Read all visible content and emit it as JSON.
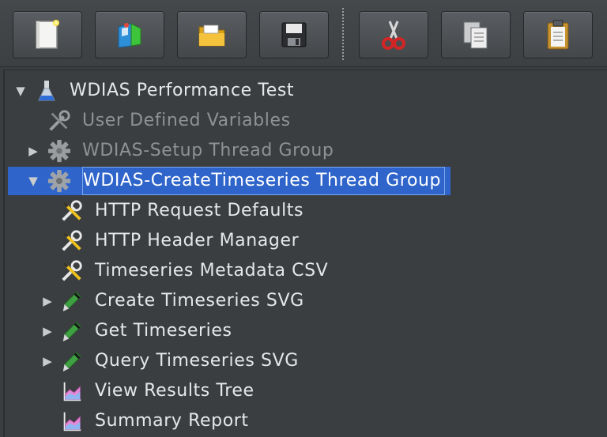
{
  "toolbar": {
    "buttons": [
      {
        "name": "new",
        "icon": "new-document-icon"
      },
      {
        "name": "templates",
        "icon": "templates-icon"
      },
      {
        "name": "open",
        "icon": "open-folder-icon"
      },
      {
        "name": "save",
        "icon": "save-floppy-icon"
      },
      {
        "name": "cut",
        "icon": "scissors-icon"
      },
      {
        "name": "copy",
        "icon": "copy-icon"
      },
      {
        "name": "paste",
        "icon": "clipboard-icon"
      }
    ]
  },
  "tree": {
    "items": [
      {
        "label": "WDIAS Performance Test",
        "icon": "flask-icon",
        "toggle": "expanded",
        "enabled": true
      },
      {
        "label": "User Defined Variables",
        "icon": "wrench-icon",
        "toggle": "none",
        "enabled": false
      },
      {
        "label": "WDIAS-Setup Thread Group",
        "icon": "gear-icon",
        "toggle": "collapsed",
        "enabled": false
      },
      {
        "label": "WDIAS-CreateTimeseries Thread Group",
        "icon": "gear-icon",
        "toggle": "expanded",
        "enabled": true,
        "selected": true
      },
      {
        "label": "HTTP Request Defaults",
        "icon": "config-tools-icon",
        "toggle": "none",
        "enabled": true
      },
      {
        "label": "HTTP Header Manager",
        "icon": "config-tools-icon",
        "toggle": "none",
        "enabled": true
      },
      {
        "label": "Timeseries Metadata CSV",
        "icon": "config-tools-icon",
        "toggle": "none",
        "enabled": true
      },
      {
        "label": "Create Timeseries SVG",
        "icon": "pipette-icon",
        "toggle": "collapsed",
        "enabled": true
      },
      {
        "label": "Get Timeseries",
        "icon": "pipette-icon",
        "toggle": "collapsed",
        "enabled": true
      },
      {
        "label": "Query Timeseries SVG",
        "icon": "pipette-icon",
        "toggle": "collapsed",
        "enabled": true
      },
      {
        "label": "View Results Tree",
        "icon": "report-chart-icon",
        "toggle": "none",
        "enabled": true
      },
      {
        "label": "Summary Report",
        "icon": "report-chart-icon",
        "toggle": "none",
        "enabled": true
      }
    ]
  },
  "colors": {
    "background": "#3b3e41",
    "selection": "#2f65ca",
    "text": "#e6e7e8",
    "disabled_text": "#8f9295"
  }
}
